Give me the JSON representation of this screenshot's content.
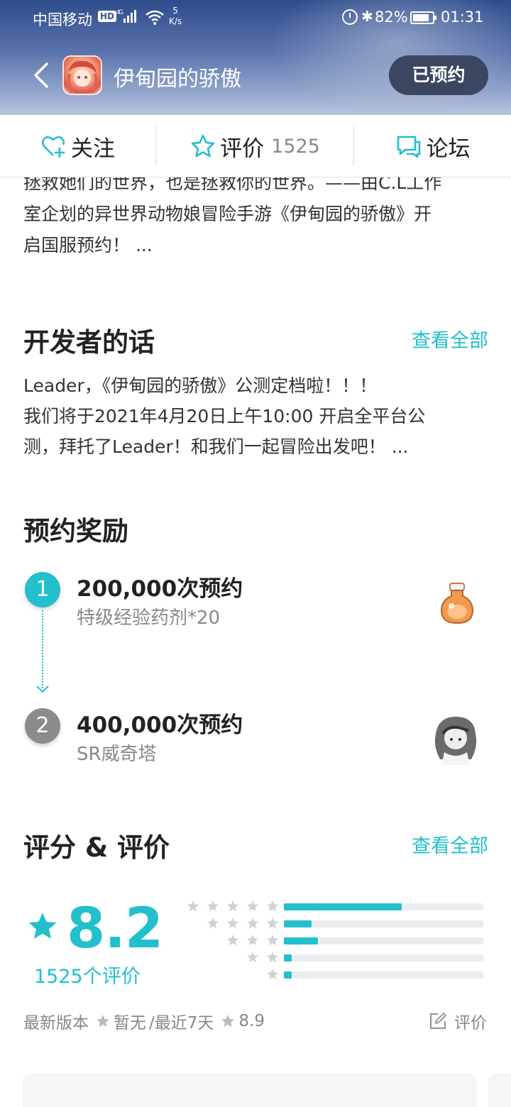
{
  "status_bar": {
    "carrier": "中国移动",
    "hd": "HD",
    "network": "4G",
    "speed_value": "5",
    "speed_unit": "K/s",
    "battery": "82%",
    "time": "01:31"
  },
  "header": {
    "title": "伊甸园的骄傲",
    "reserve_label": "已预约"
  },
  "actions": {
    "follow_label": "关注",
    "rate_label": "评价",
    "rate_count": "1525",
    "forum_label": "论坛"
  },
  "intro": {
    "line1": "拯救她们的世界，也是拯救你的世界。——由C.L工作",
    "line2": "室企划的异世界动物娘冒险手游《伊甸园的骄傲》开",
    "line3": "启国服预约！ ..."
  },
  "developer": {
    "title": "开发者的话",
    "see_all": "查看全部",
    "line1": "Leader，《伊甸园的骄傲》公测定档啦！！！",
    "line2": "我们将于2021年4月20日上午10:00 开启全平台公",
    "line3": "测，拜托了Leader！和我们一起冒险出发吧！ ..."
  },
  "rewards": {
    "title": "预约奖励",
    "items": [
      {
        "index": "1",
        "title": "200,000次预约",
        "desc": "特级经验药剂*20",
        "status_color": "#22bfcc"
      },
      {
        "index": "2",
        "title": "400,000次预约",
        "desc": "SR威奇塔",
        "status_color": "#8b8b8b"
      }
    ]
  },
  "ratings": {
    "title": "评分 & 评价",
    "see_all": "查看全部",
    "score": "8.2",
    "count_label": "1525个评价",
    "distribution": [
      {
        "stars": 5,
        "fraction": 0.59
      },
      {
        "stars": 4,
        "fraction": 0.14
      },
      {
        "stars": 3,
        "fraction": 0.17
      },
      {
        "stars": 2,
        "fraction": 0.04
      },
      {
        "stars": 1,
        "fraction": 0.04
      }
    ],
    "latest_version_label": "最新版本",
    "latest_version_value": "暂无",
    "recent_label": "/最近7天",
    "recent_value": "8.9",
    "write_review": "评价"
  },
  "colors": {
    "accent": "#22bfcc",
    "muted": "#888888",
    "button_dark": "#3b4660"
  }
}
